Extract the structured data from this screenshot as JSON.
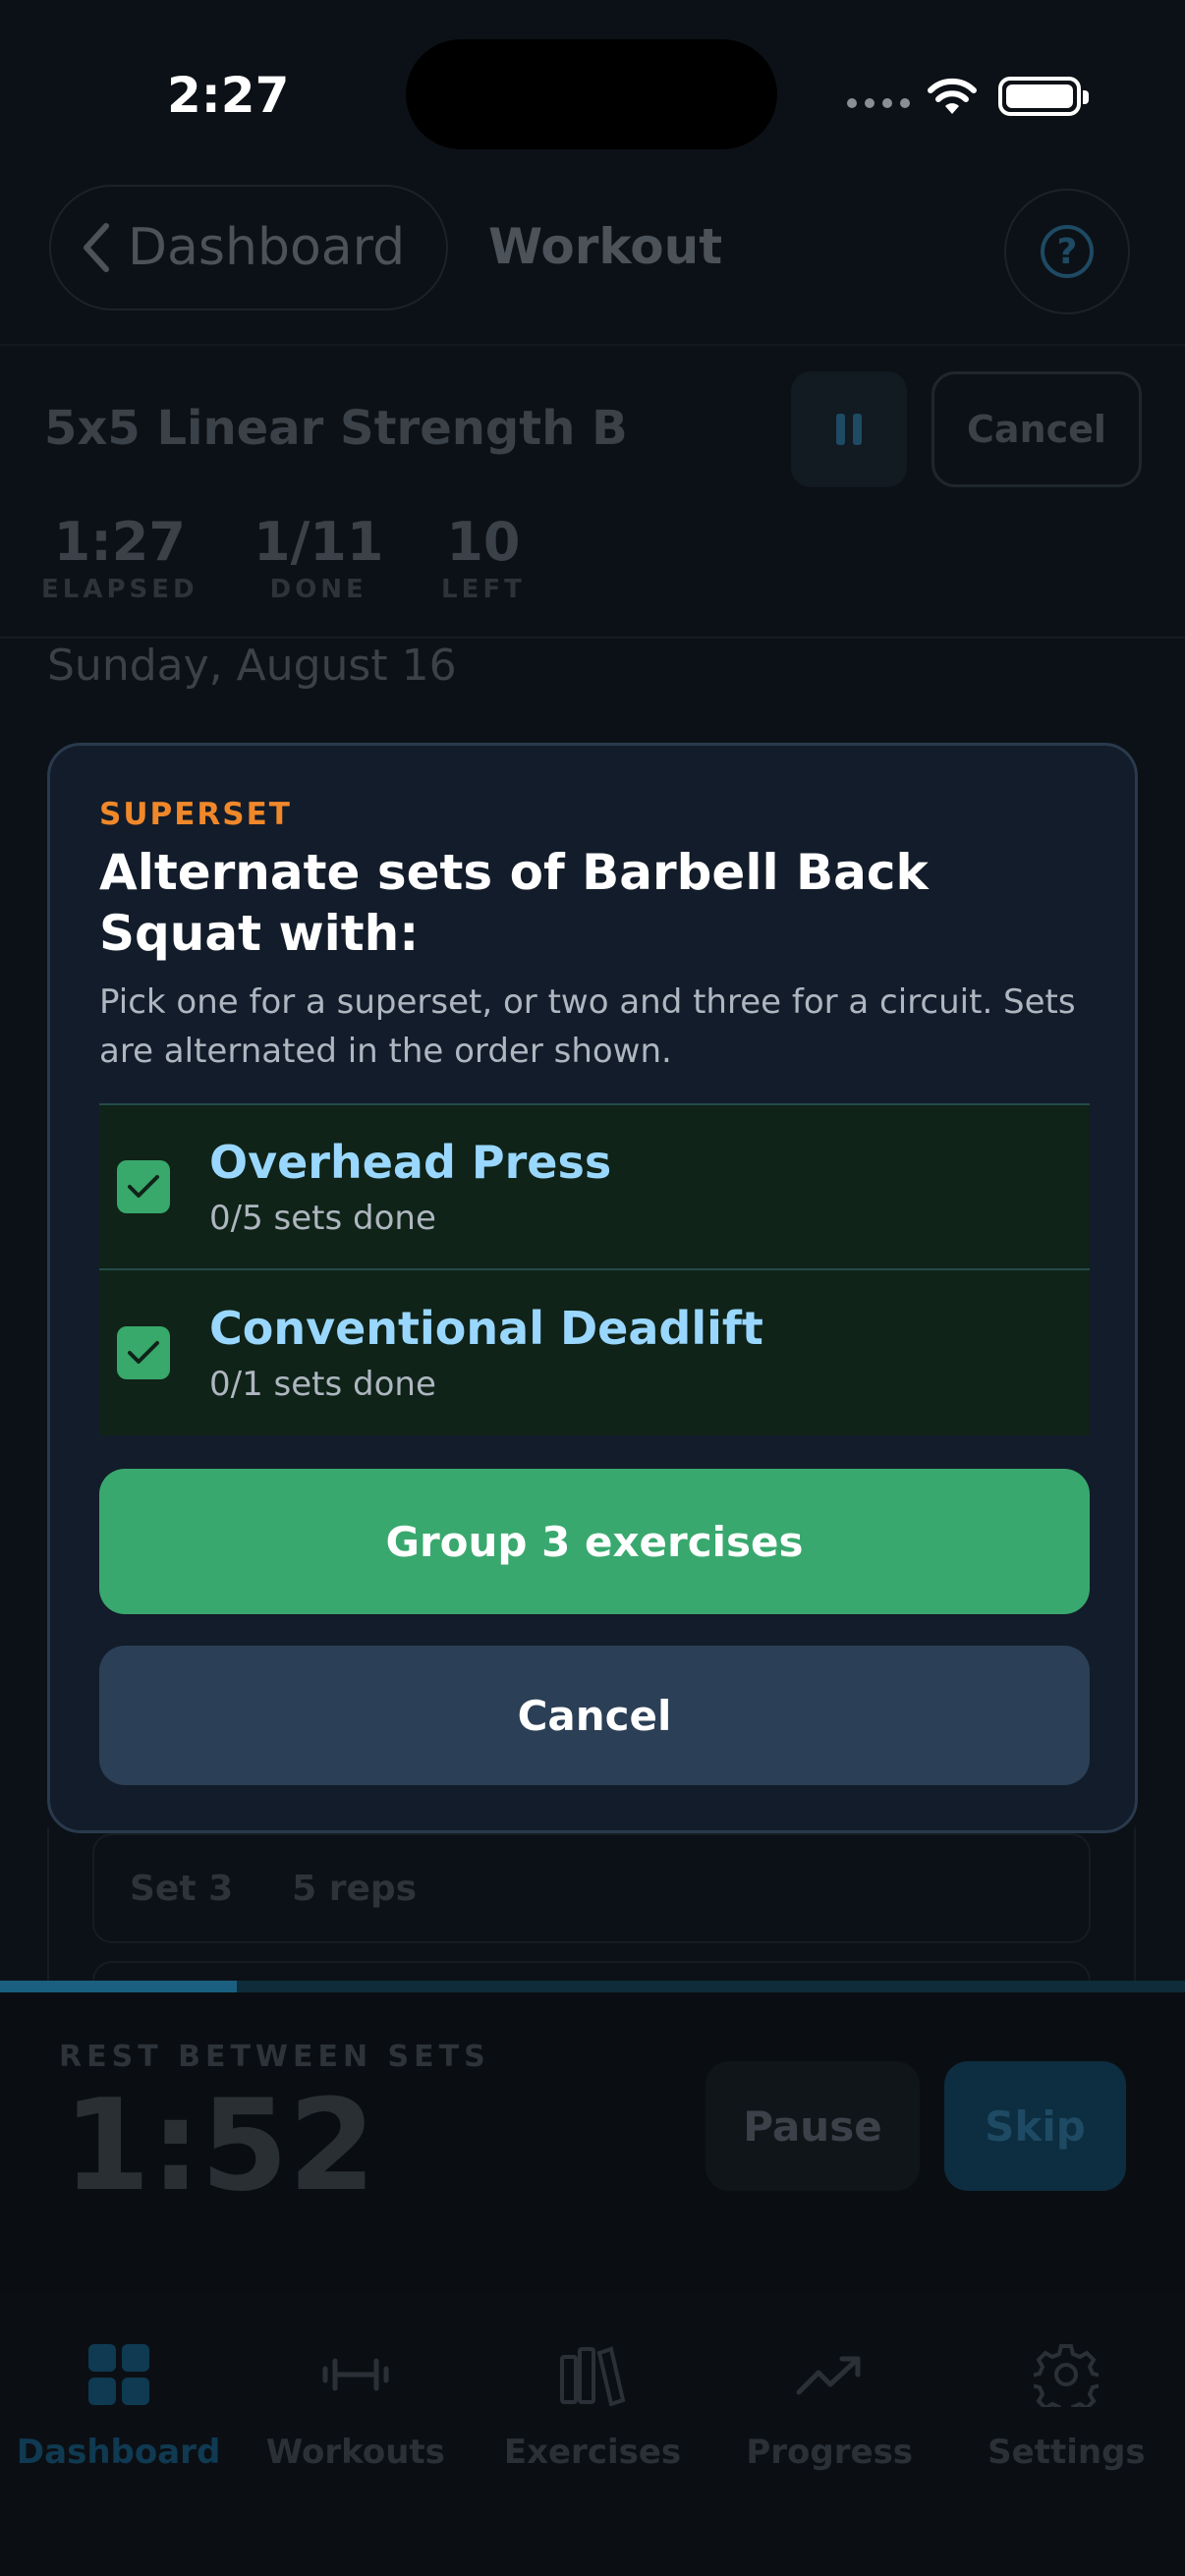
{
  "status_bar": {
    "time": "2:27"
  },
  "nav": {
    "back_label": "Dashboard",
    "title": "Workout",
    "help_icon": "question-circle-icon"
  },
  "workout": {
    "name": "5x5 Linear Strength B",
    "cancel_label": "Cancel",
    "stats": [
      {
        "value": "1:27",
        "label": "ELAPSED"
      },
      {
        "value": "1/11",
        "label": "DONE"
      },
      {
        "value": "10",
        "label": "LEFT"
      }
    ],
    "date": "Sunday, August 16",
    "set_row": {
      "set": "Set 3",
      "reps": "5 reps"
    }
  },
  "rest": {
    "label": "REST BETWEEN SETS",
    "time": "1:52",
    "progress_fraction": 0.2,
    "pause_label": "Pause",
    "skip_label": "Skip"
  },
  "modal": {
    "eyebrow": "SUPERSET",
    "title": "Alternate sets of Barbell Back Squat with:",
    "description": "Pick one for a superset, or two and three for a circuit. Sets are alternated in the order shown.",
    "options": [
      {
        "name": "Overhead Press",
        "sub": "0/5 sets done",
        "checked": true
      },
      {
        "name": "Conventional Deadlift",
        "sub": "0/1 sets done",
        "checked": true
      }
    ],
    "primary_label": "Group 3 exercises",
    "cancel_label": "Cancel"
  },
  "tabs": [
    {
      "label": "Dashboard",
      "icon": "grid-icon",
      "active": true
    },
    {
      "label": "Workouts",
      "icon": "dumbbell-icon",
      "active": false
    },
    {
      "label": "Exercises",
      "icon": "books-icon",
      "active": false
    },
    {
      "label": "Progress",
      "icon": "trend-up-icon",
      "active": false
    },
    {
      "label": "Settings",
      "icon": "gear-icon",
      "active": false
    }
  ],
  "colors": {
    "accent_orange": "#f0882a",
    "primary_green": "#39a86e",
    "option_name_blue": "#9ad7ff",
    "modal_bg": "#131c2a"
  }
}
